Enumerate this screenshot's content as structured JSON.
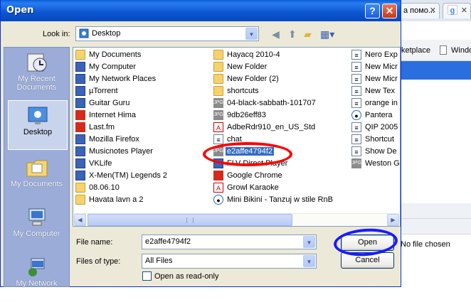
{
  "background_window": {
    "tab1_label": "а помо...",
    "tab2_label": "",
    "bookmark1": "ketplace",
    "bookmark2": "Windo",
    "no_file_text": "No file chosen"
  },
  "dialog": {
    "title": "Open",
    "look_in_label": "Look in:",
    "look_in_value": "Desktop",
    "places": [
      {
        "label": "My Recent Documents",
        "icon": "recent-documents-icon"
      },
      {
        "label": "Desktop",
        "icon": "desktop-icon"
      },
      {
        "label": "My Documents",
        "icon": "my-documents-icon"
      },
      {
        "label": "My Computer",
        "icon": "my-computer-icon"
      },
      {
        "label": "My Network",
        "icon": "my-network-icon"
      }
    ],
    "files_col1": [
      {
        "name": "My Documents",
        "type": "folder"
      },
      {
        "name": "My Computer",
        "type": "app"
      },
      {
        "name": "My Network Places",
        "type": "app"
      },
      {
        "name": "µTorrent",
        "type": "app"
      },
      {
        "name": "Guitar Guru",
        "type": "app"
      },
      {
        "name": "Internet Hima",
        "type": "red"
      },
      {
        "name": "Last.fm",
        "type": "red"
      },
      {
        "name": "Mozilla Firefox",
        "type": "app"
      },
      {
        "name": "Musicnotes Player",
        "type": "app"
      },
      {
        "name": "VKLife",
        "type": "app"
      },
      {
        "name": "X-Men(TM) Legends 2",
        "type": "app"
      },
      {
        "name": "08.06.10",
        "type": "folder"
      },
      {
        "name": "Havata lavn a 2",
        "type": "folder"
      }
    ],
    "files_col2": [
      {
        "name": "Hayacq 2010-4",
        "type": "folder"
      },
      {
        "name": "New Folder",
        "type": "folder"
      },
      {
        "name": "New Folder (2)",
        "type": "folder"
      },
      {
        "name": "shortcuts",
        "type": "folder"
      },
      {
        "name": "04-black-sabbath-101707",
        "type": "jpg"
      },
      {
        "name": "9db26eff83",
        "type": "jpg"
      },
      {
        "name": "AdbeRdr910_en_US_Std",
        "type": "pdf"
      },
      {
        "name": "chat",
        "type": "doc"
      },
      {
        "name": "e2affe4794f2",
        "type": "jpg",
        "selected": true
      },
      {
        "name": "FLV Direct Player",
        "type": "app"
      },
      {
        "name": "Google Chrome",
        "type": "red"
      },
      {
        "name": "Growl Karaoke",
        "type": "pdf"
      },
      {
        "name": "Mini Bikini - Tanzuj w stile RnB",
        "type": "mp3"
      }
    ],
    "files_col3": [
      {
        "name": "Nero Exp",
        "type": "doc"
      },
      {
        "name": "New Micr",
        "type": "doc"
      },
      {
        "name": "New Micr",
        "type": "doc"
      },
      {
        "name": "New Tex",
        "type": "doc"
      },
      {
        "name": "orange in",
        "type": "doc"
      },
      {
        "name": "Pantera",
        "type": "mp3"
      },
      {
        "name": "QIP 2005",
        "type": "doc"
      },
      {
        "name": "Shortcut",
        "type": "doc"
      },
      {
        "name": "Show De",
        "type": "doc"
      },
      {
        "name": "Weston G",
        "type": "jpg"
      }
    ],
    "file_name_label": "File name:",
    "file_name_value": "e2affe4794f2",
    "files_of_type_label": "Files of type:",
    "files_of_type_value": "All Files",
    "read_only_label": "Open as read-only",
    "open_button": "Open",
    "cancel_button": "Cancel",
    "help_glyph": "?",
    "close_glyph": "✕"
  },
  "colors": {
    "title_bar": "#0a56d0",
    "selection": "#316ac5",
    "annotation_red": "#ff0000",
    "annotation_blue": "#1a1aff"
  }
}
